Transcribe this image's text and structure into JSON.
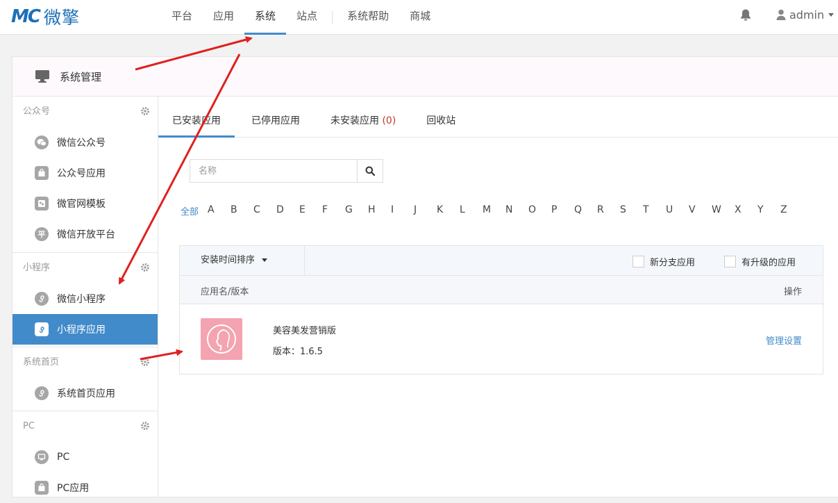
{
  "brand": {
    "mark": "MC",
    "name": "微擎"
  },
  "topnav": [
    {
      "label": "平台"
    },
    {
      "label": "应用"
    },
    {
      "label": "系统",
      "active": true
    },
    {
      "label": "站点"
    },
    {
      "label": "系统帮助"
    },
    {
      "label": "商城"
    }
  ],
  "user": {
    "name": "admin"
  },
  "panel": {
    "title": "系统管理"
  },
  "sidebar": {
    "groups": [
      {
        "title": "公众号",
        "items": [
          "微信公众号",
          "公众号应用",
          "微官网模板",
          "微信开放平台"
        ]
      },
      {
        "title": "小程序",
        "items": [
          "微信小程序",
          "小程序应用"
        ]
      },
      {
        "title": "系统首页",
        "items": [
          "系统首页应用"
        ]
      },
      {
        "title": "PC",
        "items": [
          "PC",
          "PC应用"
        ]
      }
    ],
    "active_item": "小程序应用",
    "icon_glyph_open": "平"
  },
  "tabs": [
    {
      "label": "已安装应用",
      "active": true
    },
    {
      "label": "已停用应用"
    },
    {
      "label": "未安装应用",
      "count": "(0)"
    },
    {
      "label": "回收站"
    }
  ],
  "search": {
    "placeholder": "名称"
  },
  "letters": {
    "all": "全部",
    "list": [
      "A",
      "B",
      "C",
      "D",
      "E",
      "F",
      "G",
      "H",
      "I",
      "J",
      "K",
      "L",
      "M",
      "N",
      "O",
      "P",
      "Q",
      "R",
      "S",
      "T",
      "U",
      "V",
      "W",
      "X",
      "Y",
      "Z"
    ]
  },
  "table": {
    "sort_label": "安装时间排序",
    "filter_new_branch": "新分支应用",
    "filter_upgradable": "有升级的应用",
    "col_name": "应用名/版本",
    "col_action": "操作",
    "rows": [
      {
        "name": "美容美发营销版",
        "version": "版本：1.6.5",
        "action": "管理设置"
      }
    ]
  },
  "colors": {
    "accent": "#428bca",
    "brand": "#1c6fb8",
    "arrow": "#e02020",
    "app_icon_bg": "#f4a3b0"
  }
}
